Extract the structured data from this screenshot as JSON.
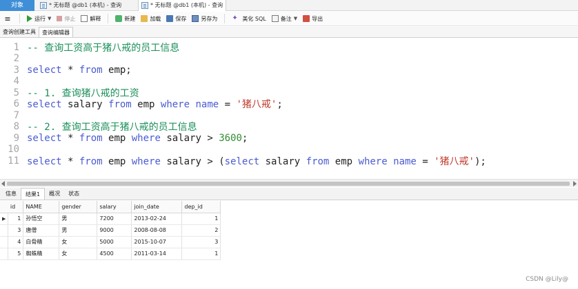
{
  "tabs": {
    "objects": "对象",
    "doc1": "* 无标题 @db1 (本机) - 查询",
    "doc2": "* 无标题 @db1 (本机) - 查询"
  },
  "toolbar": {
    "menu_glyph": "≡",
    "run": "运行",
    "stop": "停止",
    "explain": "解释",
    "new": "新建",
    "load": "加载",
    "save": "保存",
    "save_as": "另存为",
    "beautify": "美化 SQL",
    "comment": "备注",
    "export": "导出"
  },
  "subtabs": {
    "builder": "查询创建工具",
    "editor": "查询编辑器"
  },
  "editor": {
    "lines": [
      {
        "n": "1",
        "parts": [
          {
            "t": "-- 查询工资高于猪八戒的员工信息",
            "k": "comment"
          }
        ]
      },
      {
        "n": "2",
        "parts": []
      },
      {
        "n": "3",
        "parts": [
          {
            "t": "select",
            "k": "kw"
          },
          {
            "t": " * ",
            "k": "plain"
          },
          {
            "t": "from",
            "k": "kw"
          },
          {
            "t": " emp;",
            "k": "plain"
          }
        ]
      },
      {
        "n": "4",
        "parts": []
      },
      {
        "n": "5",
        "parts": [
          {
            "t": "-- 1. 查询猪八戒的工资",
            "k": "comment"
          }
        ]
      },
      {
        "n": "6",
        "parts": [
          {
            "t": "select",
            "k": "kw"
          },
          {
            "t": " salary ",
            "k": "plain"
          },
          {
            "t": "from",
            "k": "kw"
          },
          {
            "t": " emp ",
            "k": "plain"
          },
          {
            "t": "where",
            "k": "kw"
          },
          {
            "t": " ",
            "k": "plain"
          },
          {
            "t": "name",
            "k": "kw"
          },
          {
            "t": " = ",
            "k": "plain"
          },
          {
            "t": "'猪八戒'",
            "k": "str"
          },
          {
            "t": ";",
            "k": "plain"
          }
        ]
      },
      {
        "n": "7",
        "parts": []
      },
      {
        "n": "8",
        "parts": [
          {
            "t": "-- 2. 查询工资高于猪八戒的员工信息",
            "k": "comment"
          }
        ]
      },
      {
        "n": "9",
        "parts": [
          {
            "t": "select",
            "k": "kw"
          },
          {
            "t": " * ",
            "k": "plain"
          },
          {
            "t": "from",
            "k": "kw"
          },
          {
            "t": " emp ",
            "k": "plain"
          },
          {
            "t": "where",
            "k": "kw"
          },
          {
            "t": " salary > ",
            "k": "plain"
          },
          {
            "t": "3600",
            "k": "num"
          },
          {
            "t": ";",
            "k": "plain"
          }
        ]
      },
      {
        "n": "10",
        "parts": []
      },
      {
        "n": "11",
        "parts": [
          {
            "t": "select",
            "k": "kw"
          },
          {
            "t": " * ",
            "k": "plain"
          },
          {
            "t": "from",
            "k": "kw"
          },
          {
            "t": " emp ",
            "k": "plain"
          },
          {
            "t": "where",
            "k": "kw"
          },
          {
            "t": " salary > (",
            "k": "plain"
          },
          {
            "t": "select",
            "k": "kw"
          },
          {
            "t": " salary ",
            "k": "plain"
          },
          {
            "t": "from",
            "k": "kw"
          },
          {
            "t": " emp ",
            "k": "plain"
          },
          {
            "t": "where",
            "k": "kw"
          },
          {
            "t": " ",
            "k": "plain"
          },
          {
            "t": "name",
            "k": "kw"
          },
          {
            "t": " = ",
            "k": "plain"
          },
          {
            "t": "'猪八戒'",
            "k": "str"
          },
          {
            "t": ");",
            "k": "plain"
          }
        ]
      }
    ]
  },
  "result_tabs": {
    "info": "信息",
    "result1": "结果1",
    "overview": "概况",
    "status": "状态"
  },
  "grid": {
    "columns": [
      "id",
      "NAME",
      "gender",
      "salary",
      "join_date",
      "dep_id"
    ],
    "rows": [
      [
        "1",
        "孙悟空",
        "男",
        "7200",
        "2013-02-24",
        "1"
      ],
      [
        "3",
        "唐僧",
        "男",
        "9000",
        "2008-08-08",
        "2"
      ],
      [
        "4",
        "白骨精",
        "女",
        "5000",
        "2015-10-07",
        "3"
      ],
      [
        "5",
        "蜘蛛精",
        "女",
        "4500",
        "2011-03-14",
        "1"
      ]
    ],
    "current_row_marker": "▶"
  },
  "watermark": "CSDN @Lily@"
}
